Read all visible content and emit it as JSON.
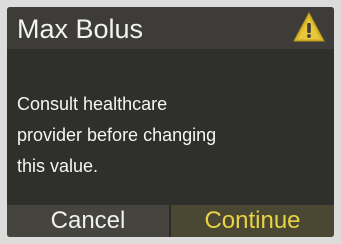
{
  "header": {
    "title": "Max Bolus",
    "icon": "warning-icon"
  },
  "message": {
    "lines": [
      "Consult healthcare",
      "provider before changing",
      "this value."
    ]
  },
  "softkeys": {
    "left_label": "Cancel",
    "right_label": "Continue"
  },
  "colors": {
    "screen_bg": "#2f2f2c",
    "warning_yellow": "#e0bf2a",
    "continue_text": "#e8d246"
  }
}
